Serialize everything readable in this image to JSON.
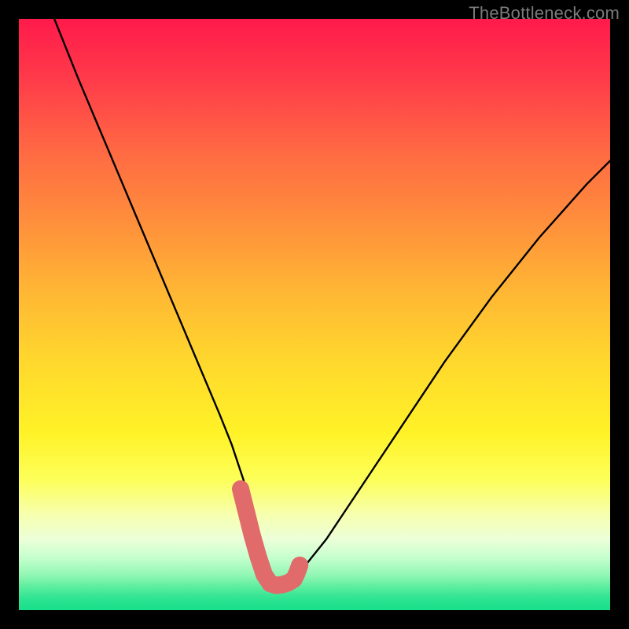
{
  "watermark": "TheBottleneck.com",
  "chart_data": {
    "type": "line",
    "title": "",
    "xlabel": "",
    "ylabel": "",
    "xlim": [
      0,
      100
    ],
    "ylim": [
      0,
      100
    ],
    "series": [
      {
        "name": "bottleneck-curve",
        "x": [
          6,
          10,
          14,
          18,
          22,
          26,
          30,
          34,
          36,
          38,
          39,
          40,
          41,
          42,
          43,
          44,
          45,
          46,
          48,
          52,
          56,
          60,
          64,
          68,
          72,
          76,
          80,
          84,
          88,
          92,
          96,
          100
        ],
        "y": [
          100,
          90,
          80.5,
          71,
          61.5,
          52,
          42.5,
          33,
          28,
          22,
          18,
          14,
          10.5,
          7.5,
          5.5,
          4.5,
          4.5,
          5,
          7,
          12,
          18,
          24,
          30,
          36,
          42,
          47.5,
          53,
          58,
          63,
          67.5,
          72,
          76
        ]
      },
      {
        "name": "valley-marker",
        "x": [
          37.5,
          38.5,
          39.5,
          40.5,
          41.5,
          42.5,
          43.5,
          44.5,
          45.5,
          46.5,
          47.0,
          47.5
        ],
        "y": [
          20.5,
          16.5,
          12.5,
          9.0,
          6.0,
          4.5,
          4.2,
          4.3,
          4.6,
          5.2,
          6.2,
          7.6
        ]
      }
    ],
    "background_gradient": {
      "type": "vertical",
      "stops": [
        {
          "pos": 0.0,
          "color": "#ff1a4b"
        },
        {
          "pos": 0.22,
          "color": "#ff6843"
        },
        {
          "pos": 0.46,
          "color": "#ffb634"
        },
        {
          "pos": 0.7,
          "color": "#fff227"
        },
        {
          "pos": 0.88,
          "color": "#ecffd8"
        },
        {
          "pos": 1.0,
          "color": "#17df8b"
        }
      ]
    }
  }
}
